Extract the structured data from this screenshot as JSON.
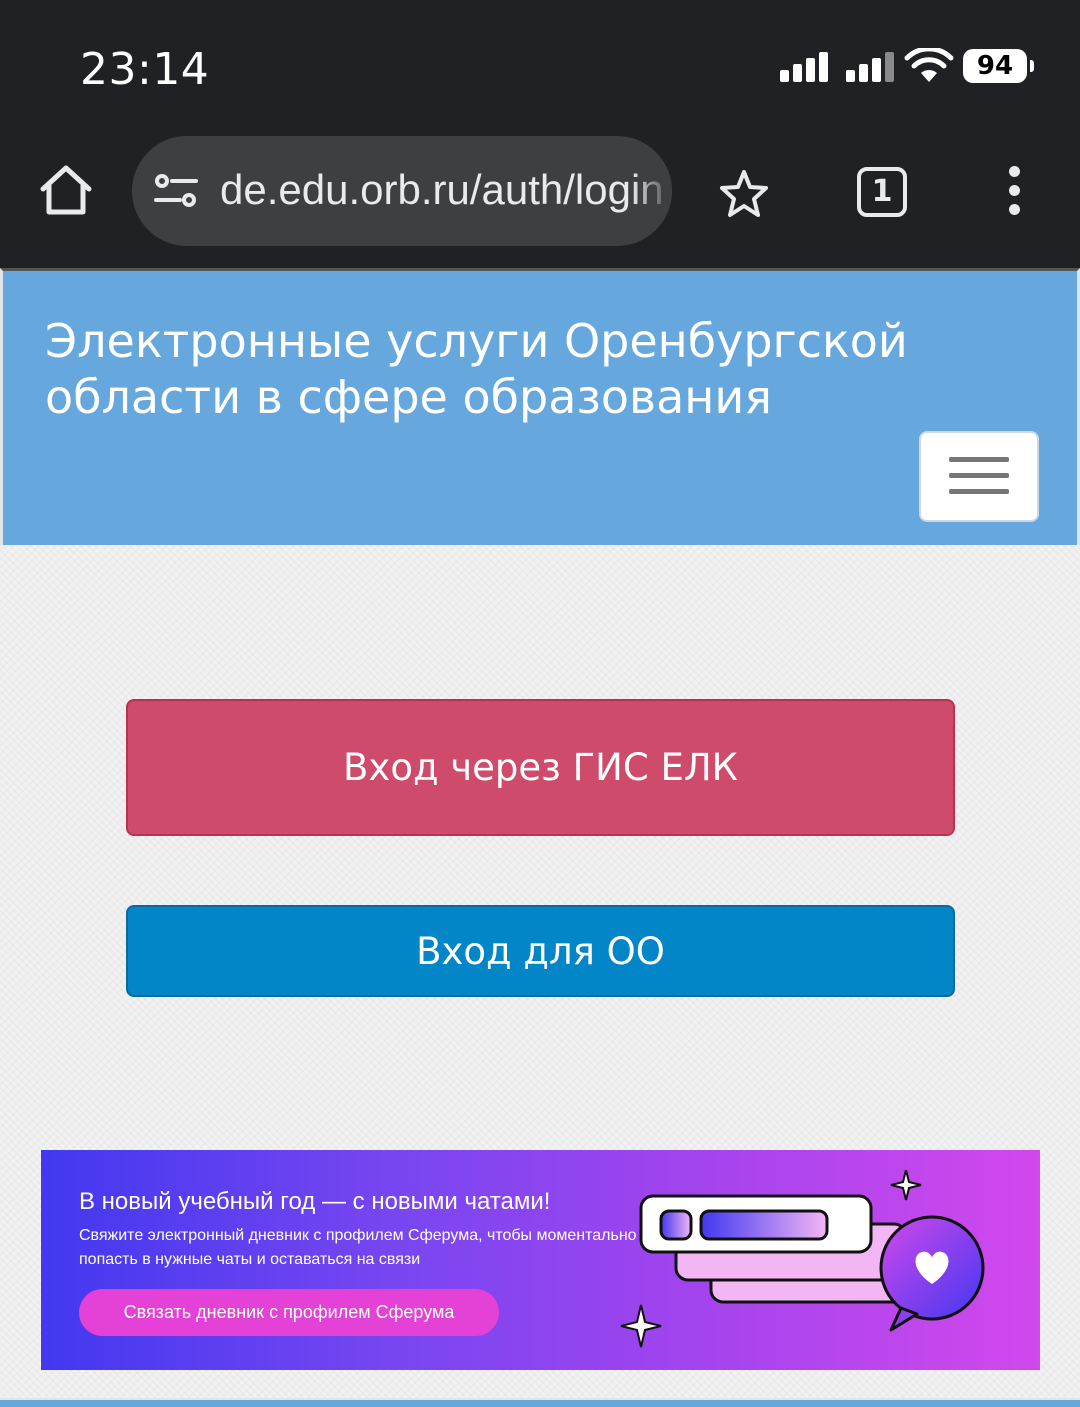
{
  "status_bar": {
    "time": "23:14",
    "battery": "94",
    "icons": [
      "signal-1-icon",
      "signal-2-icon",
      "wifi-icon",
      "battery-icon"
    ]
  },
  "browser": {
    "url": "de.edu.orb.ru/auth/login",
    "tab_count": "1",
    "icons": [
      "home-icon",
      "site-settings-icon",
      "bookmark-star-icon",
      "tabs-icon",
      "more-vert-icon"
    ]
  },
  "header": {
    "title": "Электронные услуги Оренбургской области в сфере образования",
    "menu_icon": "hamburger-icon",
    "background": "#66a8dd"
  },
  "login": {
    "gis_button": "Вход через ГИС ЕЛК",
    "gis_color": "#cf4b6c",
    "oo_button": "Вход для ОО",
    "oo_color": "#0286c7"
  },
  "banner": {
    "title": "В новый учебный год — с новыми чатами!",
    "subtitle": "Свяжите электронный дневник с профилем Сферума, чтобы моментально попасть в нужные чаты и оставаться на связи",
    "button": "Связать дневник с профилем Сферума",
    "illustration": "chat-heart-illustration"
  }
}
